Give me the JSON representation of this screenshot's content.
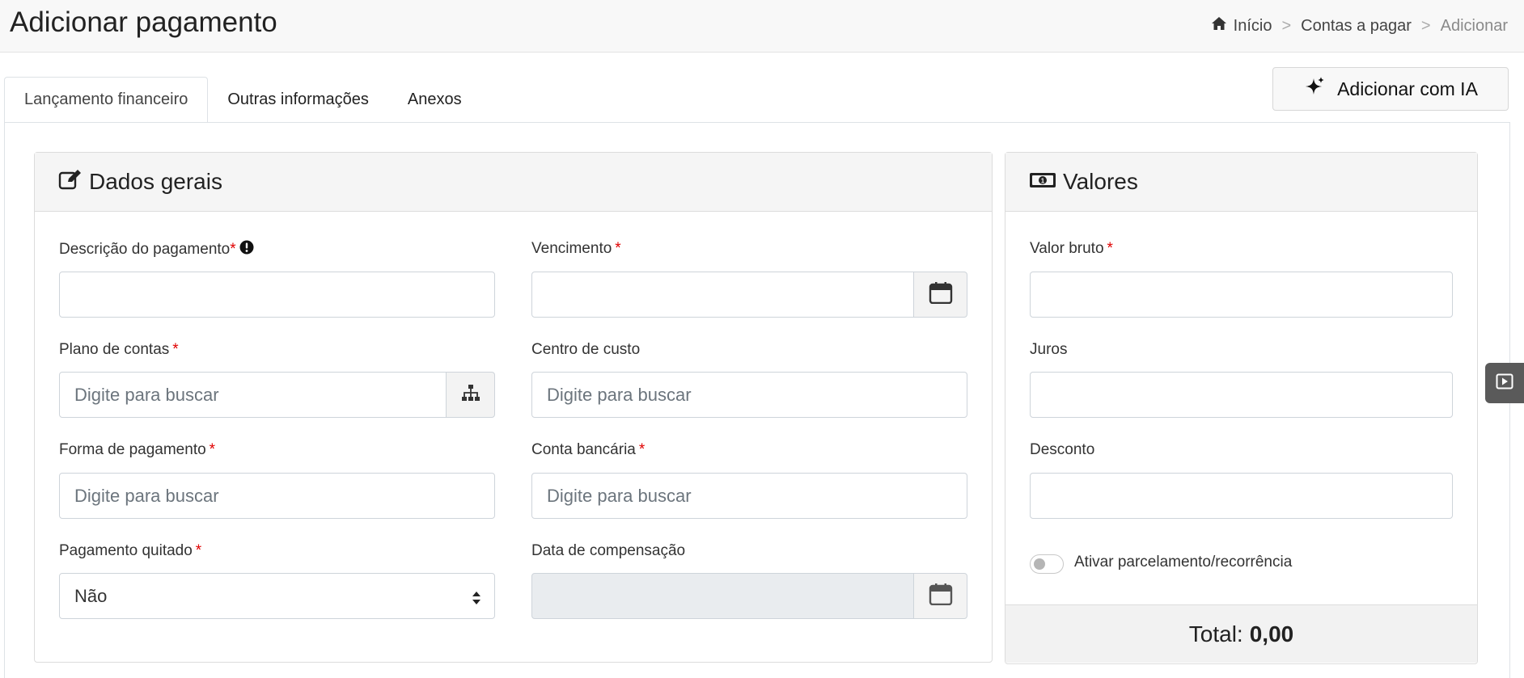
{
  "header": {
    "title": "Adicionar pagamento",
    "breadcrumb": {
      "home": "Início",
      "sep": ">",
      "parent": "Contas a pagar",
      "current": "Adicionar"
    }
  },
  "tabs": [
    {
      "label": "Lançamento financeiro",
      "active": true
    },
    {
      "label": "Outras informações",
      "active": false
    },
    {
      "label": "Anexos",
      "active": false
    }
  ],
  "ai_button": {
    "label": "Adicionar com IA",
    "icon": "sparkle-icon"
  },
  "dados_gerais": {
    "title": "Dados gerais",
    "icon": "edit-icon",
    "descricao": {
      "label": "Descrição do pagamento",
      "required": "*",
      "value": ""
    },
    "vencimento": {
      "label": "Vencimento",
      "required": "*",
      "value": ""
    },
    "plano_contas": {
      "label": "Plano de contas",
      "required": "*",
      "placeholder": "Digite para buscar"
    },
    "centro_custo": {
      "label": "Centro de custo",
      "placeholder": "Digite para buscar"
    },
    "forma_pagamento": {
      "label": "Forma de pagamento",
      "required": "*",
      "placeholder": "Digite para buscar"
    },
    "conta_bancaria": {
      "label": "Conta bancária",
      "required": "*",
      "placeholder": "Digite para buscar"
    },
    "pagamento_quitado": {
      "label": "Pagamento quitado",
      "required": "*",
      "value": "Não"
    },
    "data_compensacao": {
      "label": "Data de compensação",
      "value": ""
    }
  },
  "valores": {
    "title": "Valores",
    "icon": "money-bill-icon",
    "valor_bruto": {
      "label": "Valor bruto",
      "required": "*",
      "value": ""
    },
    "juros": {
      "label": "Juros",
      "value": ""
    },
    "desconto": {
      "label": "Desconto",
      "value": ""
    },
    "parcelamento": {
      "label": "Ativar parcelamento/recorrência",
      "enabled": false
    },
    "total": {
      "label": "Total:",
      "value": "0,00"
    }
  },
  "colors": {
    "required": "#e00000",
    "header_bg": "#f5f5f5",
    "side_tab": "#5a5a5a"
  }
}
